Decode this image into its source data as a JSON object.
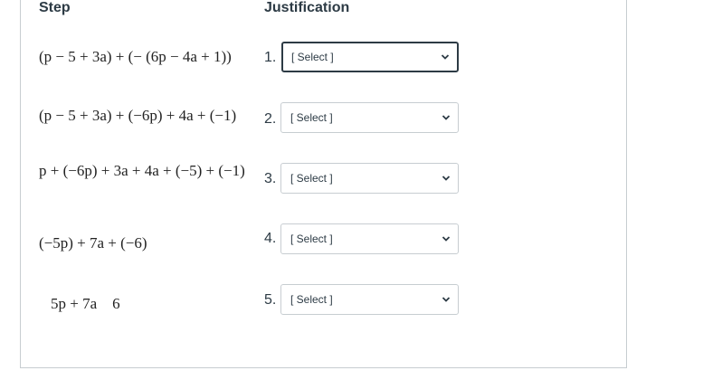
{
  "headers": {
    "step": "Step",
    "justification": "Justification"
  },
  "rows": [
    {
      "number": "1.",
      "expression": "(p − 5 + 3a) + (− (6p − 4a + 1))",
      "select_value": "[ Select ]"
    },
    {
      "number": "2.",
      "expression": "(p − 5 + 3a) + (−6p) + 4a + (−1)",
      "select_value": "[ Select ]"
    },
    {
      "number": "3.",
      "expression": "p + (−6p) + 3a + 4a + (−5) + (−1)",
      "select_value": "[ Select ]"
    },
    {
      "number": "4.",
      "expression": "(−5p) + 7a + (−6)",
      "select_value": "[ Select ]"
    },
    {
      "number": "5.",
      "expression": "5p + 7a    6",
      "select_value": "[ Select ]"
    }
  ],
  "icons": {
    "select_arrow": "chevron-down-icon"
  }
}
